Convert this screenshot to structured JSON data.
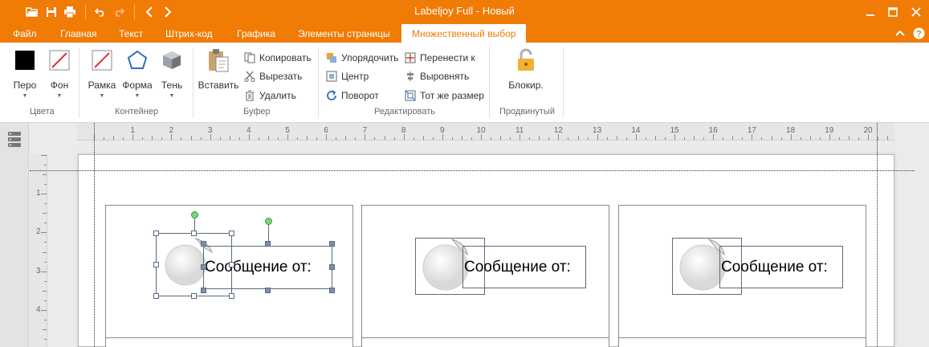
{
  "window": {
    "title": "Labeljoy Full - Новый"
  },
  "colors": {
    "accent": "#f07b05",
    "rotate_handle": "#7ed37e"
  },
  "quick_access": [
    {
      "name": "open-folder-icon"
    },
    {
      "name": "save-icon"
    },
    {
      "name": "print-icon"
    },
    {
      "name": "undo-icon"
    },
    {
      "name": "redo-icon"
    },
    {
      "name": "back-icon"
    },
    {
      "name": "forward-icon"
    }
  ],
  "tabs": [
    {
      "label": "Файл"
    },
    {
      "label": "Главная"
    },
    {
      "label": "Текст"
    },
    {
      "label": "Штрих-код"
    },
    {
      "label": "Графика"
    },
    {
      "label": "Элементы страницы"
    },
    {
      "label": "Множественный выбор",
      "active": true
    }
  ],
  "ribbon": {
    "colors_group": {
      "label": "Цвета",
      "pen": "Перо",
      "background": "Фон"
    },
    "container_group": {
      "label": "Контейнер",
      "frame": "Рамка",
      "shape": "Форма",
      "shadow": "Тень"
    },
    "clipboard_group": {
      "label": "Буфер",
      "paste": "Вставить",
      "copy": "Копировать",
      "cut": "Вырезать",
      "delete": "Удалить"
    },
    "edit_group": {
      "label": "Редактировать",
      "arrange": "Упорядочить",
      "center": "Центр",
      "rotate": "Поворот",
      "move_to": "Перенести к",
      "align": "Выровнять",
      "same_size": "Тот же размер"
    },
    "advanced_group": {
      "label": "Продвинутый",
      "lock": "Блокир."
    }
  },
  "ruler": {
    "h_numbers": [
      "1",
      "2",
      "3",
      "4",
      "5",
      "6",
      "7",
      "8",
      "9",
      "10",
      "11",
      "12",
      "13",
      "14",
      "15",
      "16",
      "17",
      "18",
      "19",
      "20"
    ],
    "v_numbers": [
      "1",
      "2",
      "3",
      "4"
    ]
  },
  "labels": [
    {
      "text": "Сообщение от:"
    },
    {
      "text": "Сообщение от:"
    },
    {
      "text": "Сообщение от:"
    }
  ]
}
